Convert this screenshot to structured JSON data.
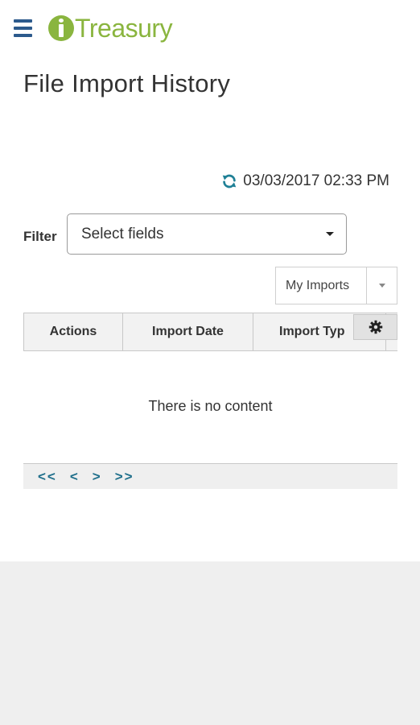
{
  "header": {
    "app_name": "Treasury",
    "menu_icon": "hamburger-icon",
    "brand_color": "#8ab53f",
    "menu_color": "#2c5a8c"
  },
  "page": {
    "title": "File Import History"
  },
  "refresh": {
    "icon": "refresh-icon",
    "timestamp": "03/03/2017 02:33 PM",
    "icon_color": "#1f8096"
  },
  "filter": {
    "label": "Filter",
    "value": "Select fields"
  },
  "imports_dropdown": {
    "value": "My Imports"
  },
  "grid": {
    "columns": [
      "Actions",
      "Import Date",
      "Import Typ"
    ],
    "settings_icon": "gear-icon",
    "empty_message": "There is no content"
  },
  "pager": {
    "first": "<<",
    "prev": "<",
    "next": ">",
    "last": ">>",
    "color": "#1f6f8b"
  }
}
